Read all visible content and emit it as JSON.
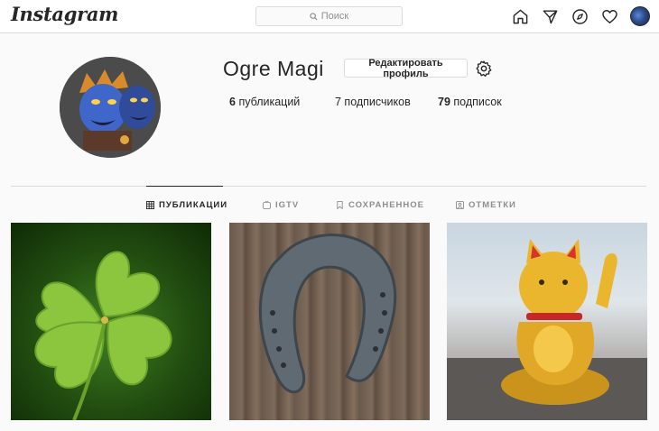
{
  "nav": {
    "logo": "Instagram",
    "search_placeholder": "Поиск",
    "icons": [
      "home-icon",
      "direct-icon",
      "explore-icon",
      "activity-icon",
      "avatar"
    ]
  },
  "profile": {
    "username": "Ogre Magi",
    "edit_label": "Редактировать профиль",
    "stats": {
      "posts_count": "6",
      "posts_label": "публикаций",
      "followers_label": "7 подписчиков",
      "following_count": "79",
      "following_label": "подписок"
    }
  },
  "tabs": [
    {
      "label": "ПУБЛИКАЦИИ",
      "active": true
    },
    {
      "label": "IGTV",
      "active": false
    },
    {
      "label": "СОХРАНЕННОЕ",
      "active": false
    },
    {
      "label": "ОТМЕТКИ",
      "active": false
    }
  ],
  "posts": [
    {
      "subject": "four-leaf clover"
    },
    {
      "subject": "horseshoe on wood"
    },
    {
      "subject": "golden lucky cat"
    }
  ],
  "colors": {
    "text": "#262626",
    "muted": "#8e8e8e",
    "border": "#dbdbdb",
    "background": "#fafafa"
  }
}
